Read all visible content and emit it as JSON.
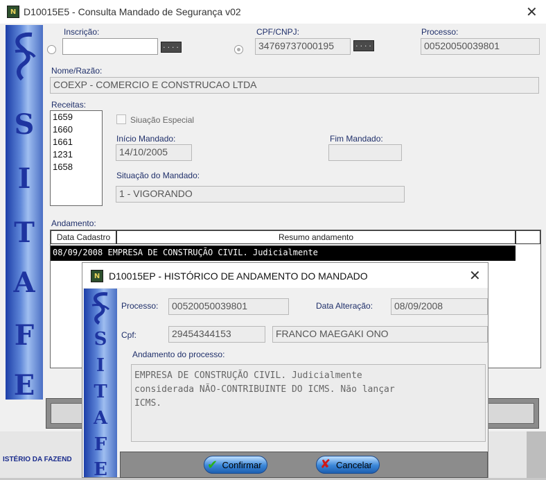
{
  "main": {
    "title": "D10015E5 - Consulta Mandado de Segurança v02",
    "app_icon": "N",
    "labels": {
      "inscricao": "Inscrição:",
      "cpf_cnpj": "CPF/CNPJ:",
      "processo": "Processo:",
      "nome_razao": "Nome/Razão:",
      "receitas": "Receitas:",
      "situacao_especial": "Siuação Especial",
      "inicio_mandado": "Início Mandado:",
      "fim_mandado": "Fim Mandado:",
      "situacao_mandado": "Situação do Mandado:",
      "andamento": "Andamento:"
    },
    "values": {
      "inscricao": "",
      "cpf_cnpj": "34769737000195",
      "processo": "00520050039801",
      "nome_razao": "COEXP - COMERCIO E CONSTRUCAO LTDA",
      "inicio_mandado": "14/10/2005",
      "fim_mandado": "",
      "situacao_mandado": "1 - VIGORANDO"
    },
    "receitas": [
      "1659",
      "1660",
      "1661",
      "1231",
      "1658"
    ],
    "grid": {
      "columns": [
        "Data Cadastro",
        "Resumo andamento"
      ],
      "rows": [
        {
          "text": "08/09/2008 EMPRESA DE CONSTRUÇÃO CIVIL. Judicialmente"
        }
      ]
    },
    "footer_text": "ISTÉRIO DA FAZEND",
    "side_letters": [
      "S",
      "I",
      "T",
      "A",
      "F",
      "E"
    ],
    "dots_label": "...."
  },
  "dialog": {
    "title": "D10015EP - HISTÓRICO DE ANDAMENTO DO MANDADO",
    "app_icon": "N",
    "labels": {
      "processo": "Processo:",
      "data_alteracao": "Data Alteração:",
      "cpf": "Cpf:",
      "andamento_processo": "Andamento do processo:"
    },
    "values": {
      "processo": "00520050039801",
      "data_alteracao": "08/09/2008",
      "cpf": "29454344153",
      "nome": "FRANCO MAEGAKI ONO",
      "andamento_line1": "EMPRESA DE CONSTRUÇÃO CIVIL. Judicialmente",
      "andamento_line2": "considerada NÃO-CONTRIBUINTE DO ICMS. Não lançar",
      "andamento_line3": "ICMS."
    },
    "buttons": {
      "confirmar": "Confirmar",
      "cancelar": "Cancelar"
    },
    "side_letters": [
      "S",
      "I",
      "T",
      "A",
      "F",
      "E"
    ]
  }
}
